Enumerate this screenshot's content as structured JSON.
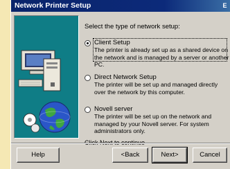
{
  "window": {
    "title": "Network Printer Setup",
    "corner_glyph": "E"
  },
  "content": {
    "prompt": "Select the type of network setup:",
    "options": [
      {
        "label": "Client Setup",
        "description": "The printer is already set up as a shared device on the network and is managed by a server or another PC.",
        "selected": true
      },
      {
        "label": "Direct Network Setup",
        "description": "The printer will be set up and managed directly over the network by this computer.",
        "selected": false
      },
      {
        "label": "Novell server",
        "description": "The printer will be set up on the network and managed by your Novell server. For system administrators only.",
        "selected": false
      }
    ],
    "hint": "Click Next to continue"
  },
  "buttons": {
    "help": "Help",
    "back": "<Back",
    "next": "Next>",
    "cancel": "Cancel"
  },
  "colors": {
    "titlebar": "#0a246a",
    "panel": "#d4d0c8",
    "art_background": "#0f7d86",
    "desktop": "#f2e6b8"
  },
  "icons": {
    "art": [
      "computer-icon",
      "globe-icon"
    ]
  }
}
